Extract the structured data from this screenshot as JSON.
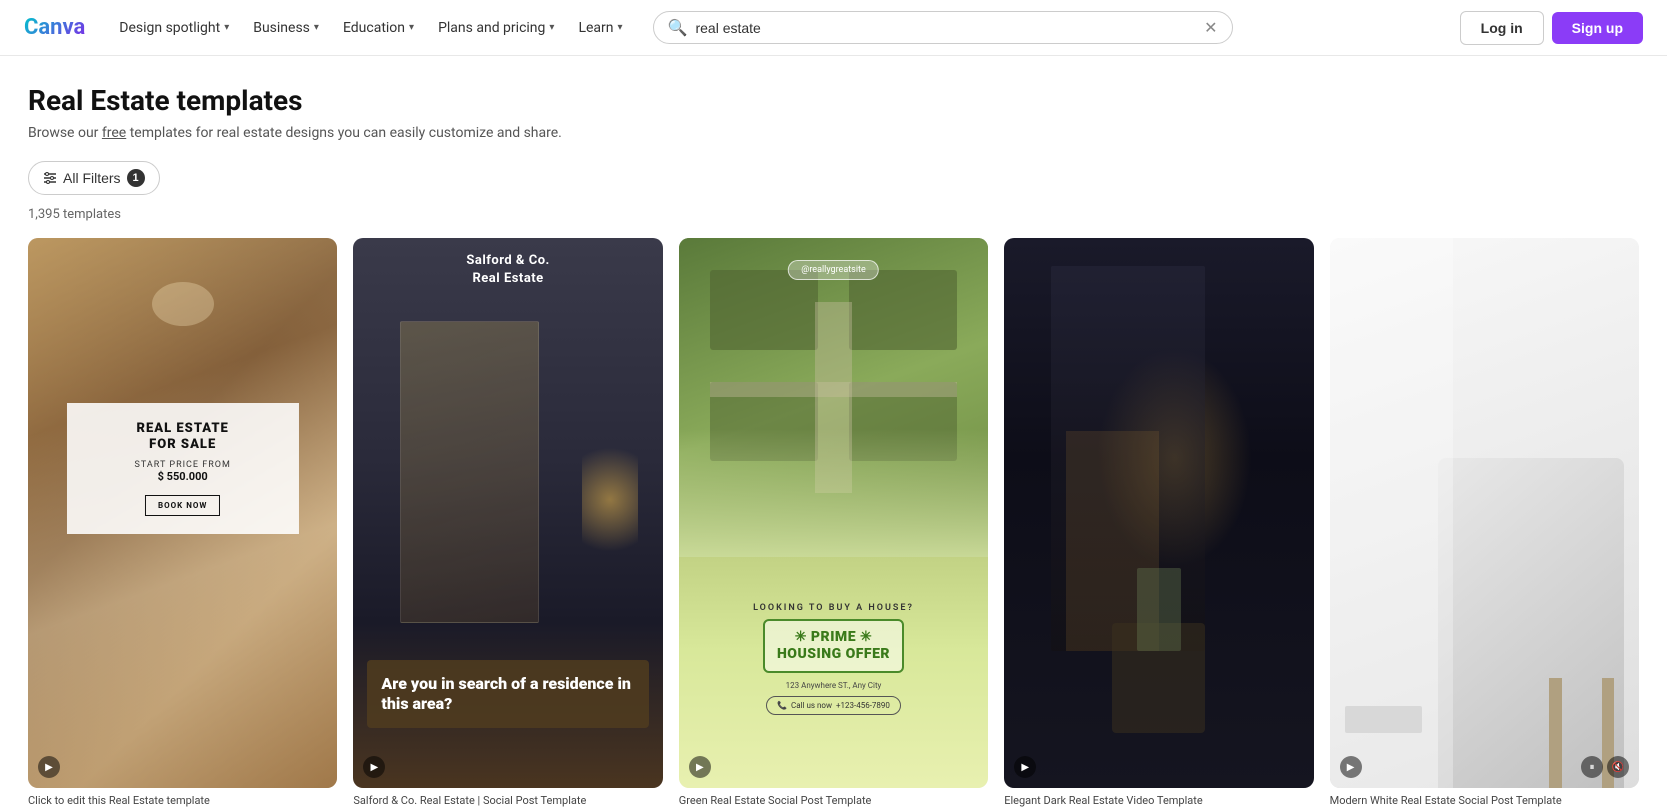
{
  "logo": {
    "text": "Canva"
  },
  "nav": {
    "items": [
      {
        "label": "Design spotlight",
        "hasDropdown": true
      },
      {
        "label": "Business",
        "hasDropdown": true
      },
      {
        "label": "Education",
        "hasDropdown": true
      },
      {
        "label": "Plans and pricing",
        "hasDropdown": true
      },
      {
        "label": "Learn",
        "hasDropdown": true
      }
    ],
    "search": {
      "placeholder": "real estate",
      "value": "real estate"
    },
    "login_label": "Log in",
    "signup_label": "Sign up"
  },
  "page": {
    "title": "Real Estate templates",
    "subtitle": "Browse our free templates for real estate designs you can easily customize and share.",
    "free_link": "free",
    "filter_label": "All Filters",
    "filter_count": "1",
    "template_count": "1,395 templates"
  },
  "templates": [
    {
      "id": "card1",
      "type": "video",
      "label": "Click to edit this Real Estate template",
      "title": "REAL ESTATE\nFOR SALE",
      "price_label": "START PRICE FROM",
      "price": "$ 550.000",
      "cta": "BOOK NOW"
    },
    {
      "id": "card2",
      "type": "video",
      "label": "Salford & Co. Real Estate | Social Post Template",
      "header_line1": "Salford & Co.",
      "header_line2": "Real Estate",
      "body_text": "Are you in search of a residence in this area?"
    },
    {
      "id": "card3",
      "type": "video",
      "label": "Green Real Estate Social Post Template",
      "handle": "@reallygreatsite",
      "looking": "LOOKING TO BUY A HOUSE?",
      "offer_line1": "✳ PRIME ✳",
      "offer_line2": "HOUSING OFFER",
      "address": "123 Anywhere ST., Any City",
      "call_label": "Call us now",
      "phone": "+123-456-7890"
    },
    {
      "id": "card4",
      "type": "video",
      "label": "Elegant Dark Real Estate Video Template"
    },
    {
      "id": "card5",
      "type": "video",
      "label": "Modern White Real Estate Social Post Template"
    }
  ]
}
